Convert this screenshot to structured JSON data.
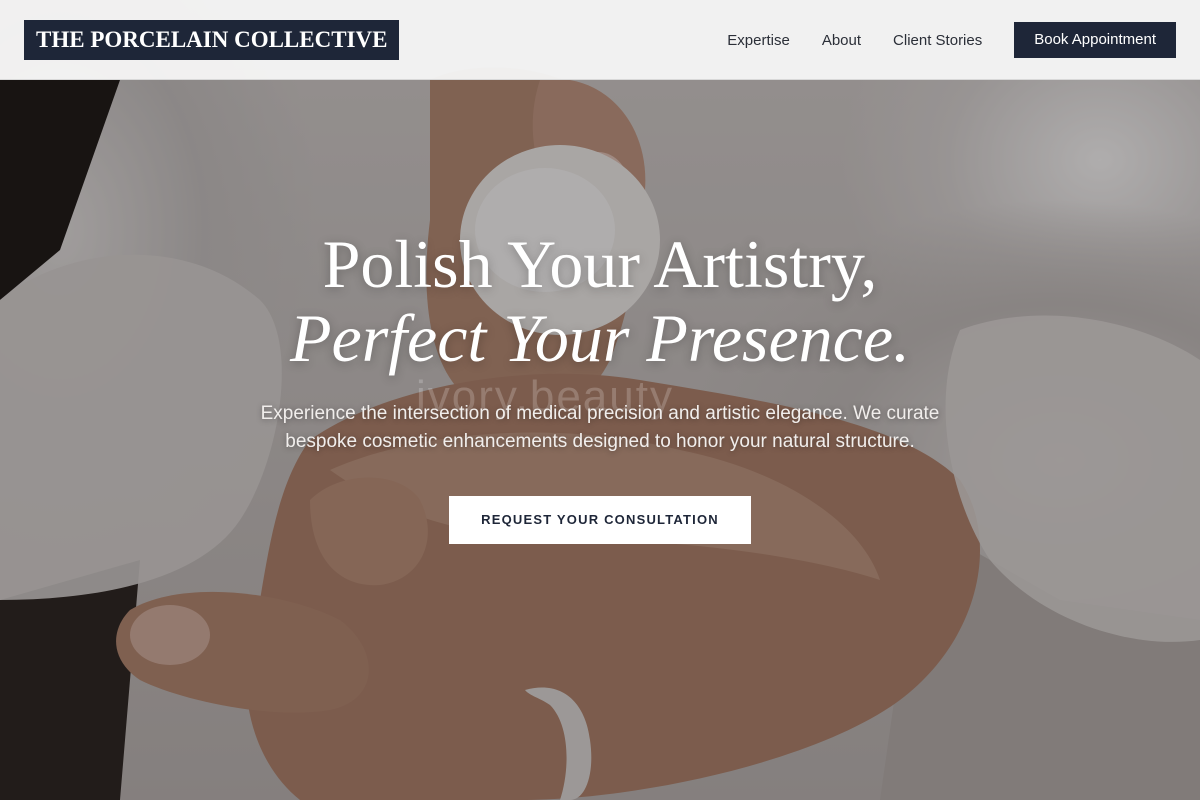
{
  "header": {
    "logo_text": "THE PORCELAIN COLLECTIVE",
    "nav": [
      {
        "label": "Expertise"
      },
      {
        "label": "About"
      },
      {
        "label": "Client Stories"
      }
    ],
    "book_button": "Book Appointment"
  },
  "hero": {
    "headline_line1": "Polish Your Artistry,",
    "headline_line2": "Perfect Your Presence.",
    "subtext": "Experience the intersection of medical precision and artistic elegance. We curate bespoke cosmetic enhancements designed to honor your natural structure.",
    "cta_label": "REQUEST YOUR CONSULTATION",
    "watermark_text": "ivory.beauty"
  },
  "colors": {
    "brand_navy": "#1e2638",
    "header_bg": "#f5f5f5",
    "cta_bg": "#ffffff"
  }
}
